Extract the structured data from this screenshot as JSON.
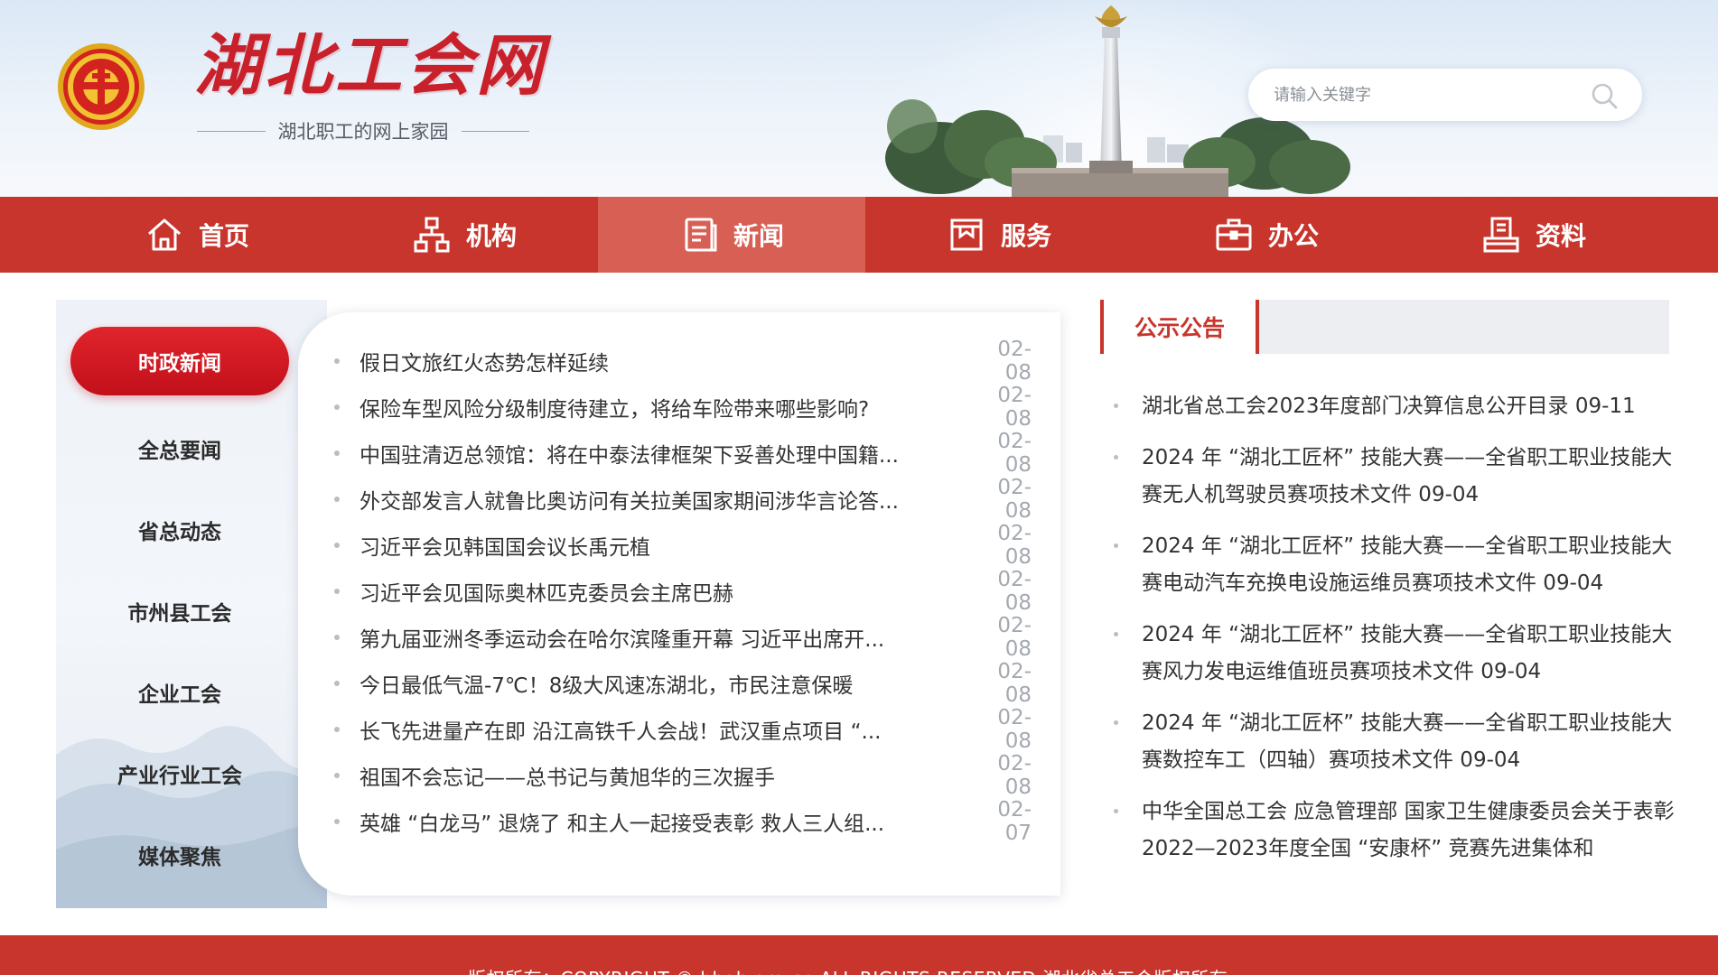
{
  "header": {
    "site_title": "湖北工会网",
    "slogan": "湖北职工的网上家园",
    "search_placeholder": "请输入关键字"
  },
  "nav": {
    "items": [
      {
        "label": "首页",
        "icon": "home-icon"
      },
      {
        "label": "机构",
        "icon": "org-chart-icon"
      },
      {
        "label": "新闻",
        "icon": "news-icon",
        "active": true
      },
      {
        "label": "服务",
        "icon": "service-icon"
      },
      {
        "label": "办公",
        "icon": "briefcase-icon"
      },
      {
        "label": "资料",
        "icon": "document-stack-icon"
      }
    ]
  },
  "side_menu": {
    "items": [
      "时政新闻",
      "全总要闻",
      "省总动态",
      "市州县工会",
      "企业工会",
      "产业行业工会",
      "媒体聚焦"
    ],
    "active_index": 0
  },
  "news": {
    "items": [
      {
        "title": "假日文旅红火态势怎样延续",
        "date": "02-08"
      },
      {
        "title": "保险车型风险分级制度待建立，将给车险带来哪些影响?",
        "date": "02-08"
      },
      {
        "title": "中国驻清迈总领馆：将在中泰法律框架下妥善处理中国籍...",
        "date": "02-08"
      },
      {
        "title": "外交部发言人就鲁比奥访问有关拉美国家期间涉华言论答...",
        "date": "02-08"
      },
      {
        "title": "习近平会见韩国国会议长禹元植",
        "date": "02-08"
      },
      {
        "title": "习近平会见国际奥林匹克委员会主席巴赫",
        "date": "02-08"
      },
      {
        "title": "第九届亚洲冬季运动会在哈尔滨隆重开幕 习近平出席开...",
        "date": "02-08"
      },
      {
        "title": "今日最低气温-7℃！8级大风速冻湖北，市民注意保暖",
        "date": "02-08"
      },
      {
        "title": "长飞先进量产在即 沿江高铁千人会战！武汉重点项目 “...",
        "date": "02-08"
      },
      {
        "title": "祖国不会忘记——总书记与黄旭华的三次握手",
        "date": "02-08"
      },
      {
        "title": "英雄 “白龙马” 退烧了 和主人一起接受表彰 救人三人组...",
        "date": "02-07"
      }
    ]
  },
  "notice": {
    "tab_label": "公示公告",
    "items": [
      "湖北省总工会2023年度部门决算信息公开目录 09-11",
      "2024 年 “湖北工匠杯” 技能大赛——全省职工职业技能大赛无人机驾驶员赛项技术文件 09-04",
      "2024 年 “湖北工匠杯” 技能大赛——全省职工职业技能大赛电动汽车充换电设施运维员赛项技术文件 09-04",
      "2024 年 “湖北工匠杯” 技能大赛——全省职工职业技能大赛风力发电运维值班员赛项技术文件 09-04",
      "2024 年 “湖北工匠杯” 技能大赛——全省职工职业技能大赛数控车工（四轴）赛项技术文件 09-04",
      "中华全国总工会 应急管理部 国家卫生健康委员会关于表彰2022—2023年度全国 “安康杯” 竞赛先进集体和"
    ]
  },
  "footer": {
    "text": "版权所有：COPYRIGHT © hbgh.org.cn ALL RIGHTS RESERVED  湖北省总工会版权所有"
  },
  "colors": {
    "brand_red": "#c8352c",
    "nav_active": "#d85f54",
    "side_active": "#d01a22"
  }
}
